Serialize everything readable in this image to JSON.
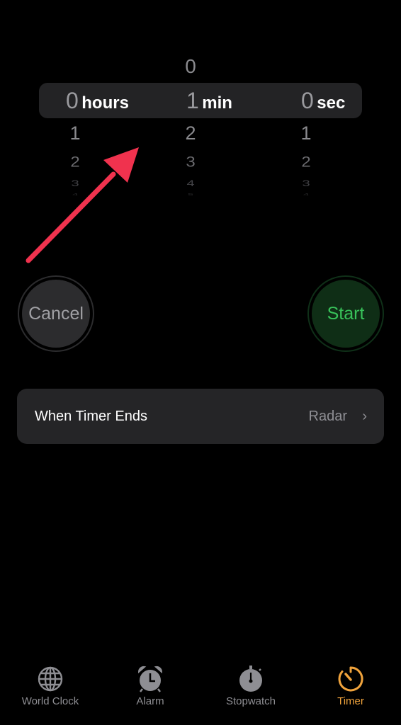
{
  "picker": {
    "hours": {
      "above": [],
      "selected": "0",
      "unit": "hours",
      "below": [
        "1",
        "2",
        "3",
        "4"
      ]
    },
    "minutes": {
      "above": [
        "0"
      ],
      "selected": "1",
      "unit": "min",
      "below": [
        "2",
        "3",
        "4",
        "5"
      ]
    },
    "seconds": {
      "above": [],
      "selected": "0",
      "unit": "sec",
      "below": [
        "1",
        "2",
        "3",
        "4"
      ]
    }
  },
  "buttons": {
    "cancel": "Cancel",
    "start": "Start"
  },
  "timer_ends": {
    "label": "When Timer Ends",
    "value": "Radar",
    "chevron": "›"
  },
  "tabbar": {
    "items": [
      {
        "label": "World Clock",
        "icon": "globe-icon",
        "active": false
      },
      {
        "label": "Alarm",
        "icon": "alarm-clock-icon",
        "active": false
      },
      {
        "label": "Stopwatch",
        "icon": "stopwatch-icon",
        "active": false
      },
      {
        "label": "Timer",
        "icon": "timer-icon",
        "active": true
      }
    ]
  },
  "colors": {
    "accent": "#f0a33c",
    "start_green": "#38c25a",
    "annotation_arrow": "#f0324e"
  }
}
